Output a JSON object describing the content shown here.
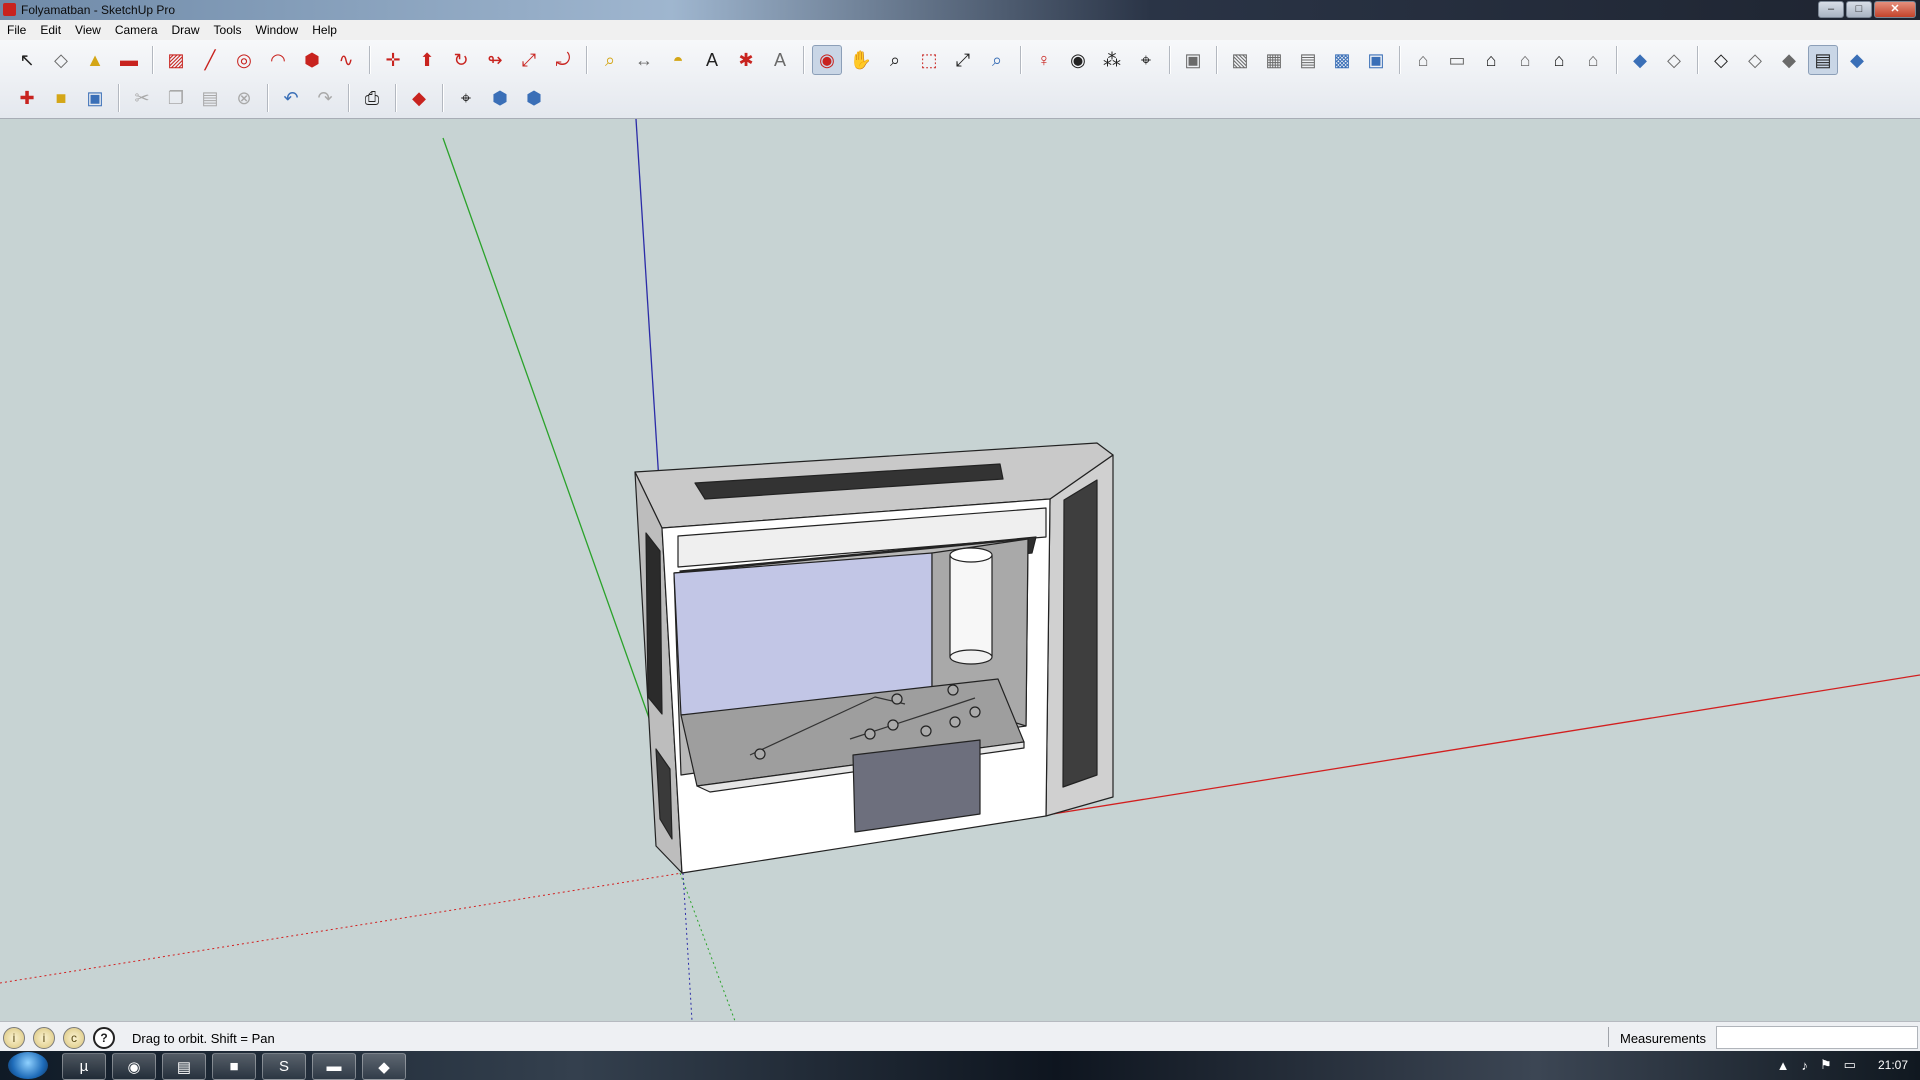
{
  "window": {
    "title": "Folyamatban - SketchUp Pro",
    "buttons": {
      "minimize": "‒",
      "maximize": "□",
      "close": "✕"
    }
  },
  "menu": [
    "File",
    "Edit",
    "View",
    "Camera",
    "Draw",
    "Tools",
    "Window",
    "Help"
  ],
  "toolbar_row1": [
    {
      "name": "select-tool-icon",
      "glyph": "↖",
      "cls": "ic-dark"
    },
    {
      "name": "make-component-icon",
      "glyph": "◇",
      "cls": "ic-gray"
    },
    {
      "name": "paint-bucket-icon",
      "glyph": "▲",
      "cls": "ic-yellow"
    },
    {
      "name": "eraser-icon",
      "glyph": "▬",
      "cls": "ic-red"
    },
    {
      "sep": true
    },
    {
      "name": "rectangle-tool-icon",
      "glyph": "▨",
      "cls": "ic-red"
    },
    {
      "name": "line-tool-icon",
      "glyph": "╱",
      "cls": "ic-red"
    },
    {
      "name": "circle-tool-icon",
      "glyph": "◎",
      "cls": "ic-red"
    },
    {
      "name": "arc-tool-icon",
      "glyph": "◠",
      "cls": "ic-red"
    },
    {
      "name": "polygon-tool-icon",
      "glyph": "⬢",
      "cls": "ic-red"
    },
    {
      "name": "freehand-tool-icon",
      "glyph": "∿",
      "cls": "ic-red"
    },
    {
      "sep": true
    },
    {
      "name": "move-tool-icon",
      "glyph": "✛",
      "cls": "ic-red"
    },
    {
      "name": "push-pull-icon",
      "glyph": "⬆",
      "cls": "ic-red"
    },
    {
      "name": "rotate-tool-icon",
      "glyph": "↻",
      "cls": "ic-red"
    },
    {
      "name": "follow-me-icon",
      "glyph": "↬",
      "cls": "ic-red"
    },
    {
      "name": "scale-tool-icon",
      "glyph": "⤢",
      "cls": "ic-red"
    },
    {
      "name": "offset-tool-icon",
      "glyph": "⤾",
      "cls": "ic-red"
    },
    {
      "sep": true
    },
    {
      "name": "tape-measure-icon",
      "glyph": "⌕",
      "cls": "ic-yellow"
    },
    {
      "name": "dimension-tool-icon",
      "glyph": "↔",
      "cls": "ic-gray"
    },
    {
      "name": "protractor-icon",
      "glyph": "◓",
      "cls": "ic-yellow"
    },
    {
      "name": "text-tool-icon",
      "glyph": "A",
      "cls": "ic-dark"
    },
    {
      "name": "axes-tool-icon",
      "glyph": "✱",
      "cls": "ic-red"
    },
    {
      "name": "3d-text-icon",
      "glyph": "A",
      "cls": "ic-gray"
    },
    {
      "sep": true
    },
    {
      "name": "orbit-tool-icon",
      "glyph": "◉",
      "cls": "ic-red",
      "active": true
    },
    {
      "name": "pan-tool-icon",
      "glyph": "✋",
      "cls": "ic-gray"
    },
    {
      "name": "zoom-tool-icon",
      "glyph": "⌕",
      "cls": "ic-dark"
    },
    {
      "name": "zoom-window-icon",
      "glyph": "⬚",
      "cls": "ic-red"
    },
    {
      "name": "zoom-extents-icon",
      "glyph": "⤢",
      "cls": "ic-dark"
    },
    {
      "name": "previous-view-icon",
      "glyph": "⌕",
      "cls": "ic-blue"
    },
    {
      "sep": true
    },
    {
      "name": "position-camera-icon",
      "glyph": "♀",
      "cls": "ic-red"
    },
    {
      "name": "look-around-icon",
      "glyph": "◉",
      "cls": "ic-dark"
    },
    {
      "name": "walk-tool-icon",
      "glyph": "⁂",
      "cls": "ic-dark"
    },
    {
      "name": "section-plane-icon",
      "glyph": "⌖",
      "cls": "ic-dark"
    },
    {
      "sep": true
    },
    {
      "name": "components-icon",
      "glyph": "▣",
      "cls": "ic-gray"
    },
    {
      "sep": true
    },
    {
      "name": "xray-style-icon",
      "glyph": "▧",
      "cls": "ic-gray"
    },
    {
      "name": "wireframe-style-icon",
      "glyph": "▦",
      "cls": "ic-gray"
    },
    {
      "name": "hidden-line-style-icon",
      "glyph": "▤",
      "cls": "ic-gray"
    },
    {
      "name": "shaded-style-icon",
      "glyph": "▩",
      "cls": "ic-blue"
    },
    {
      "name": "shaded-textures-icon",
      "glyph": "▣",
      "cls": "ic-blue"
    },
    {
      "sep": true
    },
    {
      "name": "iso-view-icon",
      "glyph": "⌂",
      "cls": "ic-gray"
    },
    {
      "name": "top-view-icon",
      "glyph": "▭",
      "cls": "ic-gray"
    },
    {
      "name": "front-view-icon",
      "glyph": "⌂",
      "cls": "ic-dark"
    },
    {
      "name": "right-view-icon",
      "glyph": "⌂",
      "cls": "ic-gray"
    },
    {
      "name": "back-view-icon",
      "glyph": "⌂",
      "cls": "ic-dark"
    },
    {
      "name": "left-view-icon",
      "glyph": "⌂",
      "cls": "ic-gray"
    },
    {
      "sep": true
    },
    {
      "name": "face-style-1-icon",
      "glyph": "◆",
      "cls": "ic-blue"
    },
    {
      "name": "face-style-2-icon",
      "glyph": "◇",
      "cls": "ic-gray"
    },
    {
      "sep": true
    },
    {
      "name": "face-style-3-icon",
      "glyph": "◇",
      "cls": "ic-dark"
    },
    {
      "name": "face-style-4-icon",
      "glyph": "◇",
      "cls": "ic-gray"
    },
    {
      "name": "face-style-5-icon",
      "glyph": "◆",
      "cls": "ic-gray"
    },
    {
      "name": "face-style-6-icon",
      "glyph": "▤",
      "cls": "ic-dark",
      "active": true
    },
    {
      "name": "face-style-7-icon",
      "glyph": "◆",
      "cls": "ic-blue"
    }
  ],
  "toolbar_row2": [
    {
      "name": "new-file-icon",
      "glyph": "✚",
      "cls": "ic-red"
    },
    {
      "name": "open-folder-icon",
      "glyph": "■",
      "cls": "ic-yellow"
    },
    {
      "name": "save-icon",
      "glyph": "▣",
      "cls": "ic-blue"
    },
    {
      "sep": true
    },
    {
      "name": "cut-icon",
      "glyph": "✂",
      "cls": "dim"
    },
    {
      "name": "copy-icon",
      "glyph": "❐",
      "cls": "dim"
    },
    {
      "name": "paste-icon",
      "glyph": "▤",
      "cls": "dim"
    },
    {
      "name": "delete-icon",
      "glyph": "⊗",
      "cls": "dim"
    },
    {
      "sep": true
    },
    {
      "name": "undo-icon",
      "glyph": "↶",
      "cls": "ic-blue"
    },
    {
      "name": "redo-icon",
      "glyph": "↷",
      "cls": "dim"
    },
    {
      "sep": true
    },
    {
      "name": "print-icon",
      "glyph": "⎙",
      "cls": "ic-dark"
    },
    {
      "sep": true
    },
    {
      "name": "model-info-icon",
      "glyph": "◆",
      "cls": "ic-red"
    },
    {
      "sep": true
    },
    {
      "name": "get-location-icon",
      "glyph": "⌖",
      "cls": "ic-dark"
    },
    {
      "name": "3d-warehouse-icon",
      "glyph": "⬢",
      "cls": "ic-blue"
    },
    {
      "name": "share-model-icon",
      "glyph": "⬢",
      "cls": "ic-blue"
    }
  ],
  "status": {
    "hint": "Drag to orbit.  Shift = Pan",
    "measurements_label": "Measurements",
    "measurements_value": ""
  },
  "taskbar": {
    "clock": "21:07",
    "apps": [
      {
        "name": "utorrent-taskbar-icon",
        "glyph": "µ"
      },
      {
        "name": "chrome-taskbar-icon",
        "glyph": "◉"
      },
      {
        "name": "notes-taskbar-icon",
        "glyph": "▤"
      },
      {
        "name": "explorer-taskbar-icon",
        "glyph": "■"
      },
      {
        "name": "skype-taskbar-icon",
        "glyph": "S"
      },
      {
        "name": "python-taskbar-icon",
        "glyph": "▬"
      },
      {
        "name": "sketchup-taskbar-icon",
        "glyph": "◆"
      }
    ]
  },
  "colors": {
    "viewport_bg": "#c7d3d3",
    "axis_red": "#d21f1f",
    "axis_green": "#2aa22a",
    "axis_blue": "#2b2ba8",
    "model_body": "#ffffff",
    "model_side": "#bdbdbd",
    "glass": "#c2c6e6",
    "panel": "#6d6f7d"
  }
}
